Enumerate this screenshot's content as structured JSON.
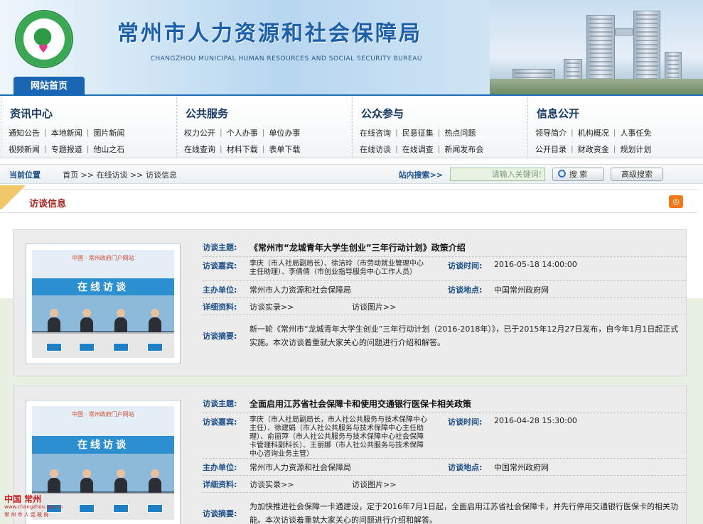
{
  "site": {
    "title": "常州市人力资源和社会保障局",
    "subtitle": "CHANGZHOU MUNICIPAL HUMAN RESOURCES AND SOCIAL SECURITY BUREAU",
    "home_tab": "网站首页"
  },
  "nav": [
    {
      "title": "资讯中心",
      "rows": [
        [
          "通知公告",
          "本地新闻",
          "图片新闻"
        ],
        [
          "视频新闻",
          "专题报道",
          "他山之石"
        ]
      ]
    },
    {
      "title": "公共服务",
      "rows": [
        [
          "权力公开",
          "个人办事",
          "单位办事"
        ],
        [
          "在线查询",
          "材料下载",
          "表单下载"
        ]
      ]
    },
    {
      "title": "公众参与",
      "rows": [
        [
          "在线咨询",
          "民意征集",
          "热点问题"
        ],
        [
          "在线访谈",
          "在线调查",
          "新闻发布会"
        ]
      ]
    },
    {
      "title": "信息公开",
      "rows": [
        [
          "领导简介",
          "机构概况",
          "人事任免"
        ],
        [
          "公开目录",
          "财政资金",
          "规划计划"
        ]
      ]
    }
  ],
  "searchbar": {
    "crumb_label": "当前位置",
    "crumbs": [
      "首页",
      "在线访谈",
      "访谈信息"
    ],
    "search_label": "站内搜索",
    "search_placeholder": "请输入关键词!",
    "search_button": "搜 索",
    "advanced_button": "高级搜索"
  },
  "section": {
    "title": "访谈信息",
    "rss": "RSS"
  },
  "interviews": [
    {
      "theme_label": "访谈主题:",
      "theme": "《常州市“龙城青年大学生创业”三年行动计划》政策介绍",
      "guests_label": "访谈嘉宾:",
      "guests": "李庆（市人社局副局长）、徐洁玲（市劳动就业管理中心主任助理）、李倩倩（市创业指导服务中心工作人员）",
      "time_label": "访谈时间:",
      "time": "2016-05-18 14:00:00",
      "host_label": "主办单位:",
      "host": "常州市人力资源和社会保障局",
      "place_label": "访谈地点:",
      "place": "中国常州政府网",
      "material_label": "详细资料:",
      "materials": [
        "访谈实录>>",
        "访谈图片>>"
      ],
      "summary_label": "访谈摘要:",
      "summary": "新一轮《常州市“龙城青年大学生创业”三年行动计划（2016-2018年）》，已于2015年12月27日发布，自今年1月1日起正式实施。本次访谈着重就大家关心的问题进行介绍和解答。",
      "thumb_banner": "在线访谈",
      "thumb_site": "中国 · 常州政府门户网站"
    },
    {
      "theme_label": "访谈主题:",
      "theme": "全面启用江苏省社会保障卡和使用交通银行医保卡相关政策",
      "guests_label": "访谈嘉宾:",
      "guests": "李庆（市人社局副局长，市人社公共服务与技术保障中心主任）、徐建娟（市人社公共服务与技术保障中心主任助理）、俞丽萍（市人社公共服务与技术保障中心社会保障卡管理科副科长）、王丽娜（市人社公共服务与技术保障中心咨询业务主管）",
      "time_label": "访谈时间:",
      "time": "2016-04-28 15:30:00",
      "host_label": "主办单位:",
      "host": "常州市人力资源和社会保障局",
      "place_label": "访谈地点:",
      "place": "中国常州政府网",
      "material_label": "详细资料:",
      "materials": [
        "访谈实录>>",
        "访谈图片>>"
      ],
      "summary_label": "访谈摘要:",
      "summary": "为加快推进社会保障一卡通建设，定于2016年7月1日起，全面启用江苏省社会保障卡，并先行停用交通银行医保卡的相关功能。本次访谈着重就大家关心的问题进行介绍和解答。",
      "thumb_banner": "在线访谈",
      "thumb_site": "中国 · 常州政府门户网站"
    }
  ],
  "footer_logo": {
    "name": "中国 常州",
    "url": "www.changzhou.gov.cn",
    "sub": "常 州 市 人 民 政 府"
  }
}
